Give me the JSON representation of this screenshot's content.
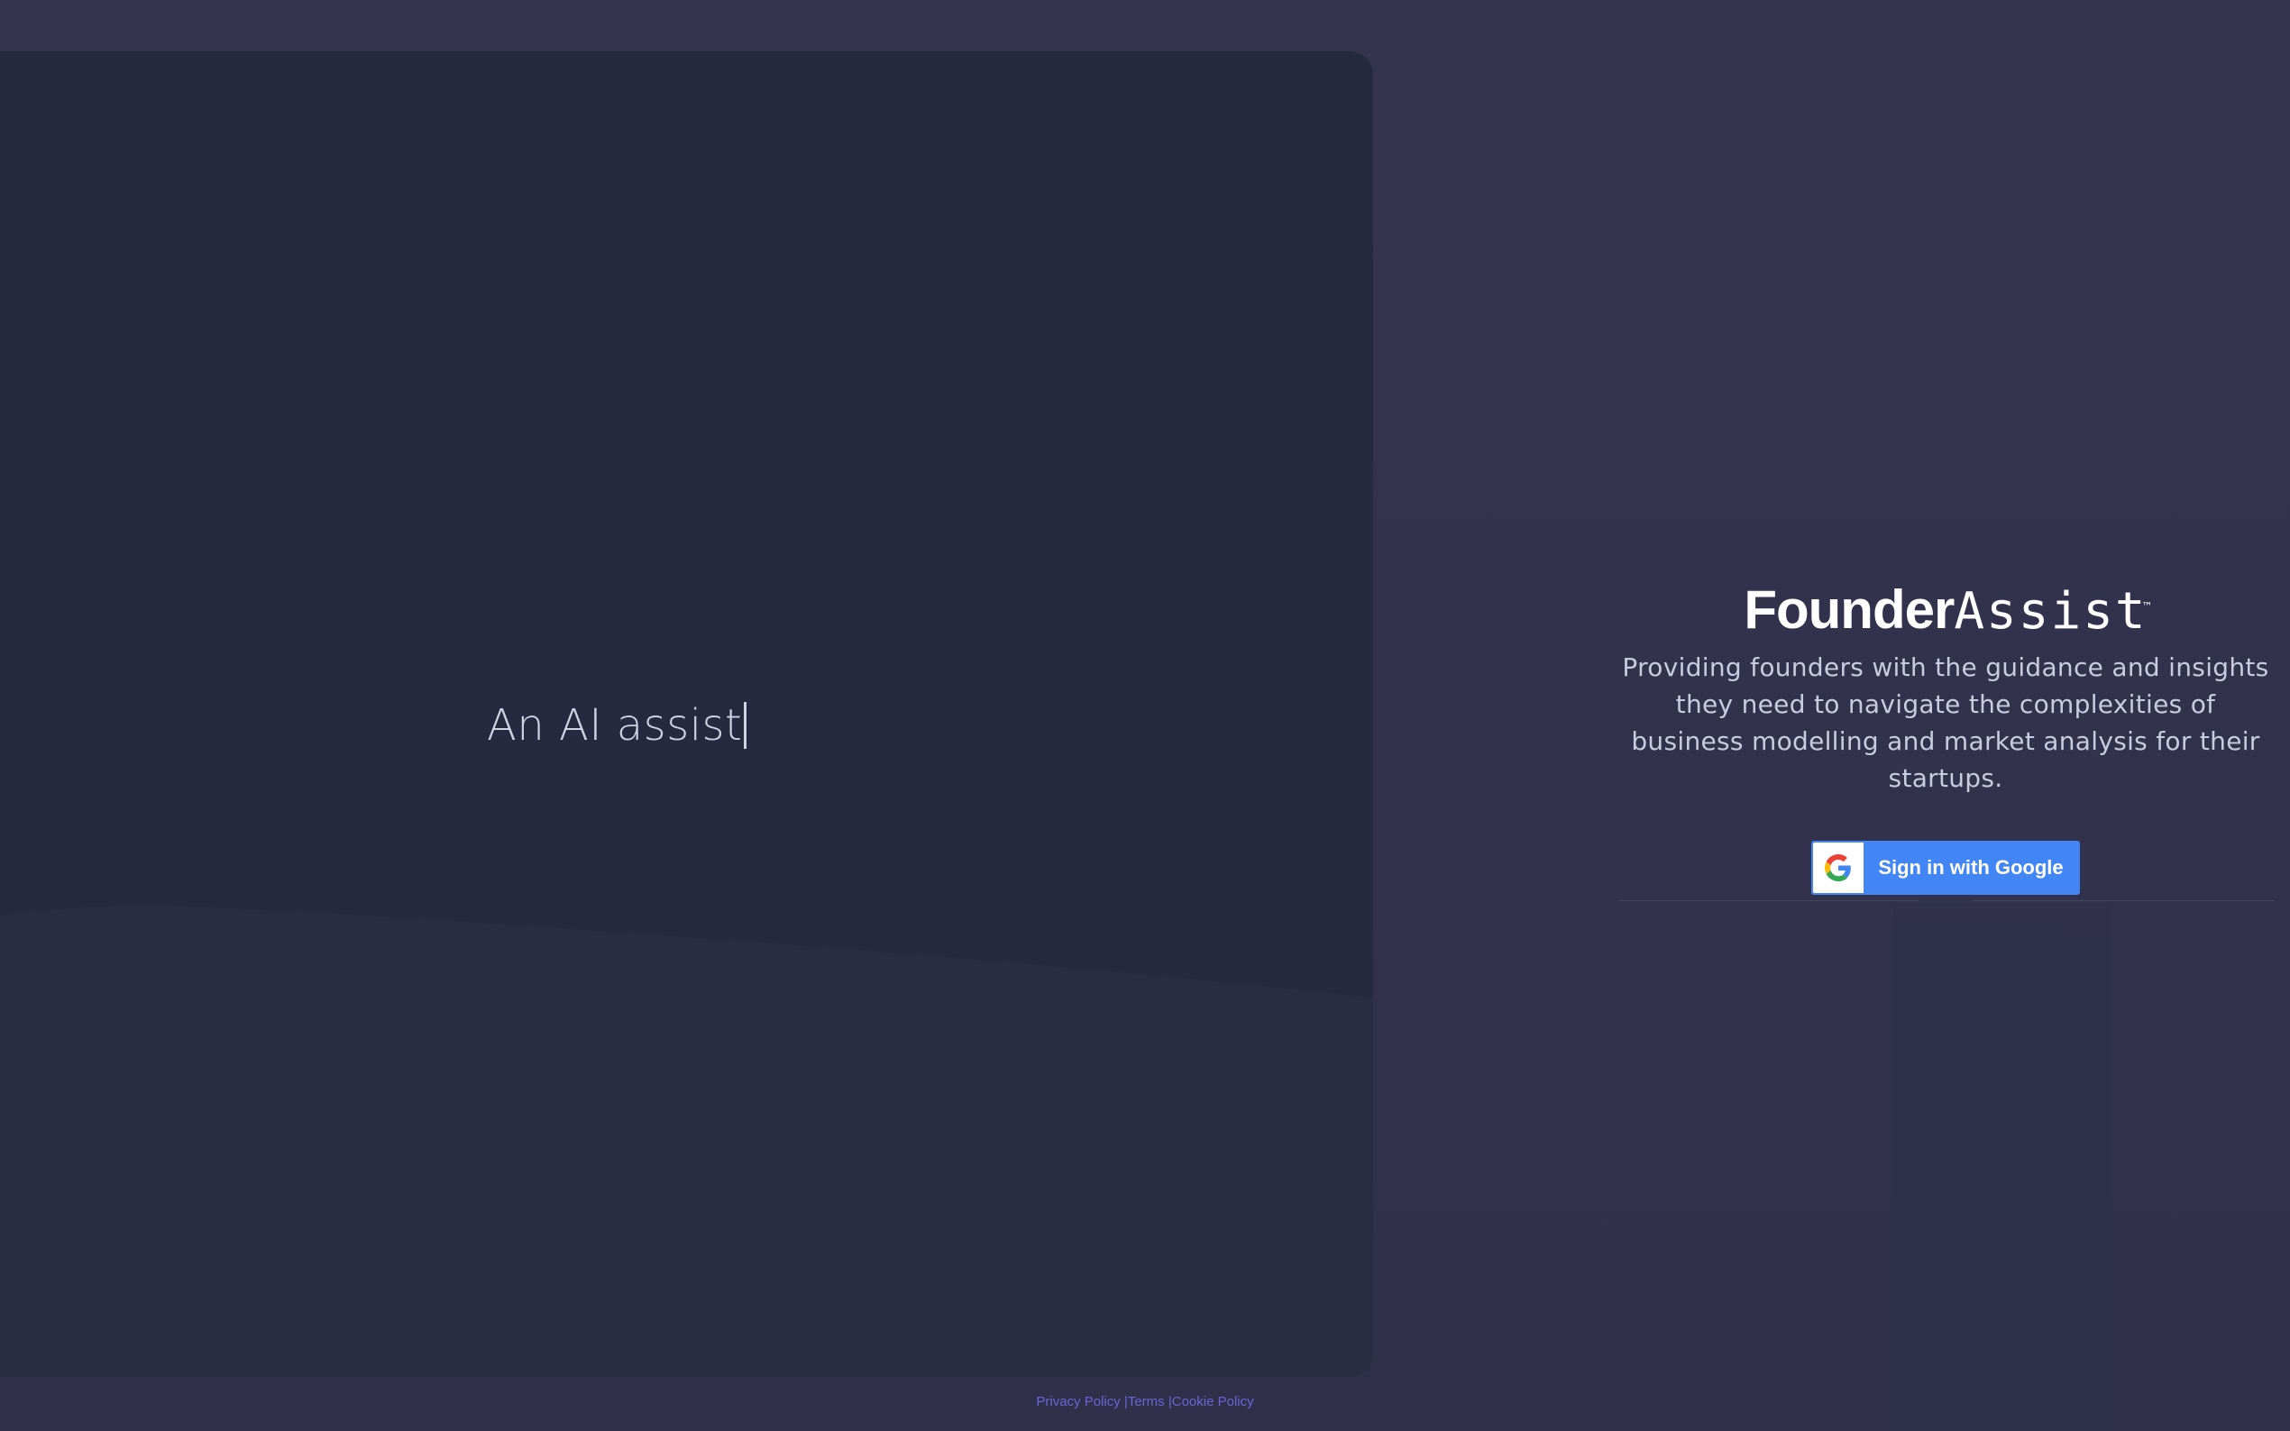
{
  "hero": {
    "typed_text": "An AI assist"
  },
  "brand": {
    "bold": "Founder",
    "light": "Assist",
    "trademark": "™"
  },
  "tagline": "Providing founders with the guidance and insights they need to navigate the complexities of business modelling and market analysis for their startups.",
  "google_button": {
    "label": "Sign in with Google",
    "icon": "google-g-icon"
  },
  "footer": {
    "privacy": "Privacy Policy",
    "terms": "Terms",
    "cookie": "Cookie Policy",
    "separator": "|"
  },
  "colors": {
    "background": "#30304a",
    "panel": "#262a40",
    "google_blue": "#4285f4",
    "footer_link": "#6f63d6"
  }
}
